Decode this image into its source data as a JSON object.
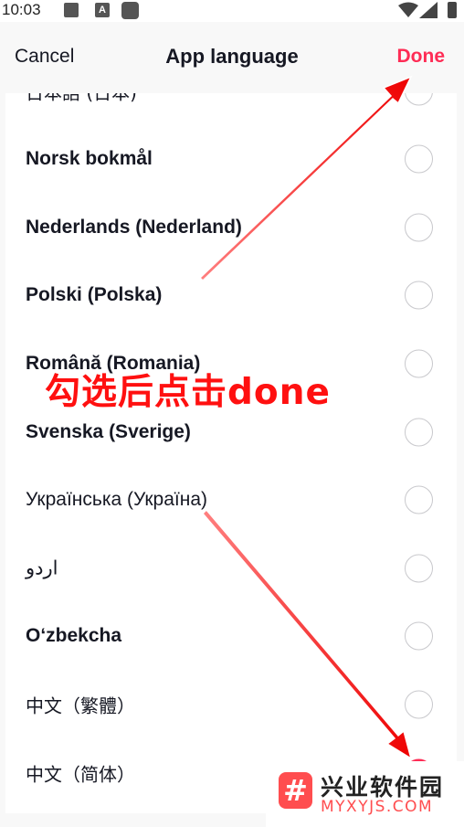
{
  "status_bar": {
    "time": "10:03",
    "icons": [
      "image-icon",
      "font-icon",
      "app-square-icon",
      "wifi-icon",
      "signal-icon",
      "battery-icon"
    ],
    "font_icon_letter": "A"
  },
  "header": {
    "cancel_label": "Cancel",
    "title": "App language",
    "done_label": "Done"
  },
  "languages": [
    {
      "label": "日本語 (日本)",
      "selected": false
    },
    {
      "label": "Norsk bokmål",
      "selected": false
    },
    {
      "label": "Nederlands (Nederland)",
      "selected": false
    },
    {
      "label": "Polski (Polska)",
      "selected": false
    },
    {
      "label": "Română (Romania)",
      "selected": false
    },
    {
      "label": "Svenska (Sverige)",
      "selected": false
    },
    {
      "label": "Українська (Україна)",
      "selected": false
    },
    {
      "label": "اردو",
      "selected": false
    },
    {
      "label": "O‘zbekcha",
      "selected": false
    },
    {
      "label": "中文（繁體）",
      "selected": false
    },
    {
      "label": "中文（简体）",
      "selected": true
    }
  ],
  "annotation": {
    "text": "勾选后点击done"
  },
  "watermark": {
    "cn": "兴业软件园",
    "en": "MYXYJS.COM"
  },
  "colors": {
    "accent": "#fe2c55",
    "arrow": "#ff1a1a"
  }
}
